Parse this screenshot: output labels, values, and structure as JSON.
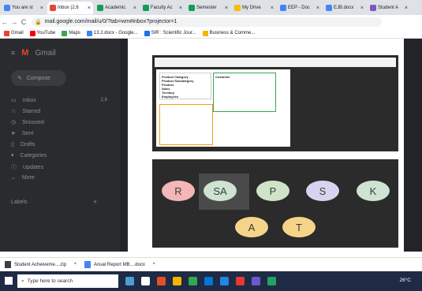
{
  "tabs": [
    {
      "label": "You are st",
      "color": "#4285f4",
      "active": false
    },
    {
      "label": "Inbox (2,6",
      "color": "#ea4335",
      "active": true
    },
    {
      "label": "Academic",
      "color": "#0f9d58",
      "active": false
    },
    {
      "label": "Faculty Ac",
      "color": "#0f9d58",
      "active": false
    },
    {
      "label": "Semester",
      "color": "#0f9d58",
      "active": false
    },
    {
      "label": "My Drive",
      "color": "#fbbc04",
      "active": false
    },
    {
      "label": "EEP - Doc",
      "color": "#4285f4",
      "active": false
    },
    {
      "label": "EJB.docx",
      "color": "#4285f4",
      "active": false
    },
    {
      "label": "Student A",
      "color": "#7e57c2",
      "active": false
    }
  ],
  "address": {
    "url": "mail.google.com/mail/u/0/?tab=wm#inbox?projector=1"
  },
  "bookmarks": [
    {
      "label": "Gmail",
      "color": "#ea4335"
    },
    {
      "label": "YouTube",
      "color": "#ff0000"
    },
    {
      "label": "Maps",
      "color": "#34a853"
    },
    {
      "label": "13.2.docx - Google...",
      "color": "#4285f4"
    },
    {
      "label": "SIR : Scientific Jour...",
      "color": "#1a73e8"
    },
    {
      "label": "Business & Comme...",
      "color": "#f4b400"
    }
  ],
  "gmail": {
    "brand": "Gmail",
    "compose": "Compose",
    "inbox_label": "Inbox",
    "inbox_count": "2,6",
    "items": [
      "Starred",
      "Snoozed",
      "Sent",
      "Drafts",
      "Categories",
      "Updates",
      "More"
    ],
    "labels_heading": "Labels"
  },
  "slide": {
    "avatars_row1": [
      {
        "letter": "R",
        "color": "#f4b6b6"
      },
      {
        "letter": "SA",
        "color": "#cfe3d2"
      },
      {
        "letter": "P",
        "color": "#cfe3c8"
      },
      {
        "letter": "S",
        "color": "#d8d4ef"
      },
      {
        "letter": "K",
        "color": "#cfe3d2"
      }
    ],
    "avatars_row2": [
      {
        "letter": "A",
        "color": "#f5d48a"
      },
      {
        "letter": "T",
        "color": "#f5d48a"
      }
    ],
    "doc_left_title": "Product Category",
    "doc_right_title": "Customer",
    "doc_left_lines": [
      "Product Subcategory",
      "Product",
      "Sales",
      "Territory",
      "Employees"
    ]
  },
  "downloads": [
    {
      "label": "Student Acheiveme....zip",
      "color": "#3c4043"
    },
    {
      "label": "Anual Report MB....docx",
      "color": "#4285f4"
    }
  ],
  "taskbar": {
    "search_placeholder": "Type here to search",
    "temperature": "26°C",
    "icons": [
      "#4b9cd3",
      "#ffffff",
      "#e34f26",
      "#f4b400",
      "#34a853",
      "#0078d4",
      "#1e88e5",
      "#e53935",
      "#6a5acd",
      "#21a366"
    ]
  }
}
